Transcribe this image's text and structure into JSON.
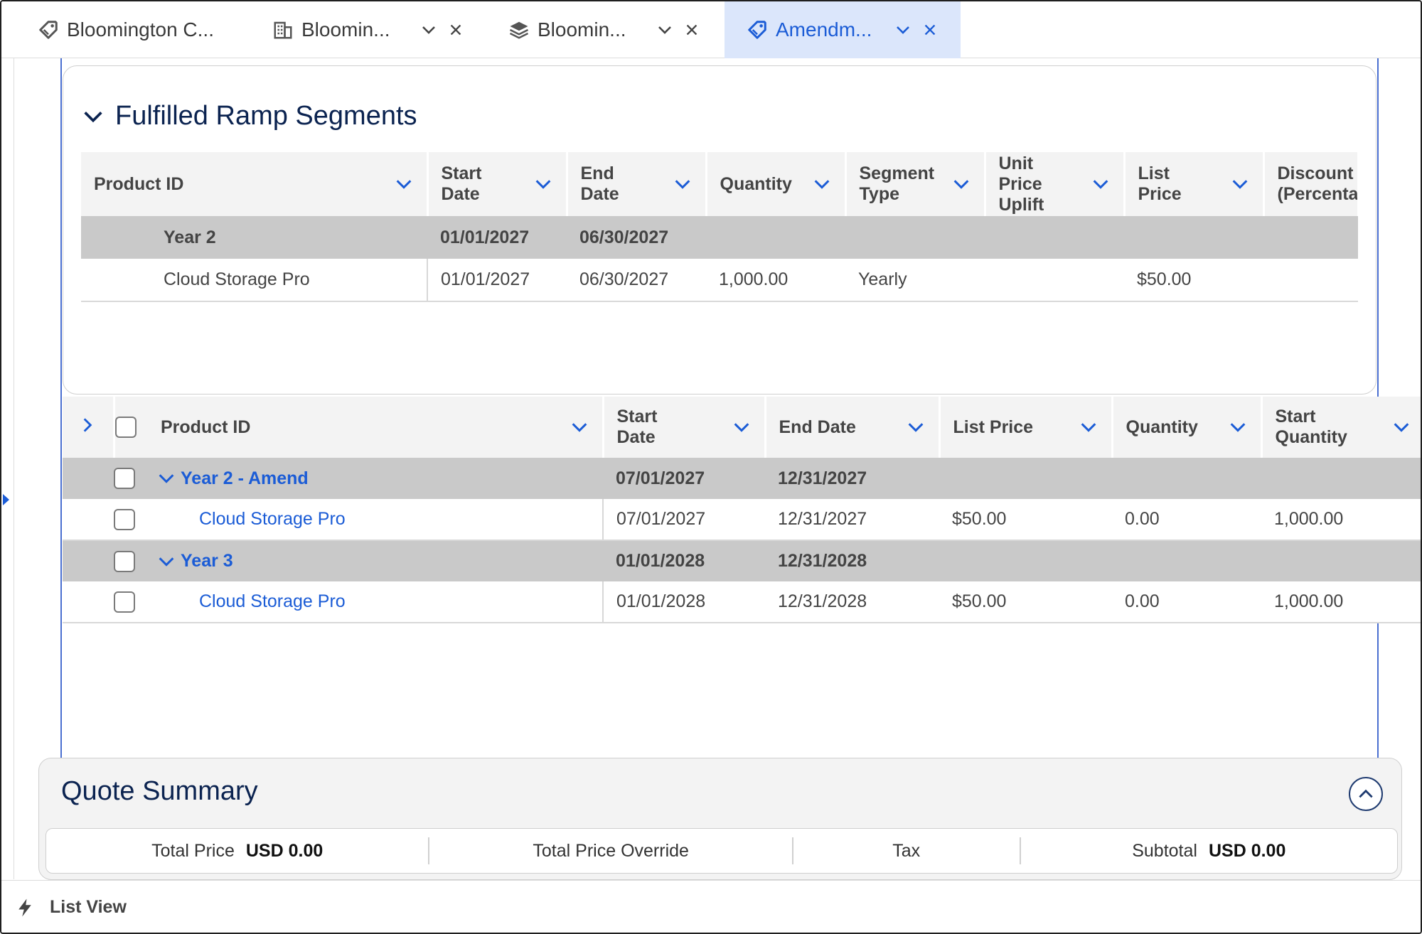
{
  "tabs": [
    {
      "label": "Bloomington C...",
      "icon": "price-tag-icon",
      "active": false
    },
    {
      "label": "Bloomin...",
      "icon": "building-icon",
      "active": false
    },
    {
      "label": "Bloomin...",
      "icon": "layers-icon",
      "active": false
    },
    {
      "label": "Amendm...",
      "icon": "price-tag-icon",
      "active": true
    }
  ],
  "fulfilled": {
    "title": "Fulfilled Ramp Segments",
    "columns": [
      "Product ID",
      "Start Date",
      "End Date",
      "Quantity",
      "Segment Type",
      "Unit Price Uplift",
      "List Price",
      "Discount (Percenta"
    ],
    "groups": [
      {
        "name": "Year 2",
        "start": "01/01/2027",
        "end": "06/30/2027",
        "rows": [
          {
            "product": "Cloud Storage Pro",
            "start": "01/01/2027",
            "end": "06/30/2027",
            "quantity": "1,000.00",
            "segment_type": "Yearly",
            "uplift": "",
            "list_price": "$50.00",
            "discount": ""
          }
        ]
      }
    ]
  },
  "lines": {
    "columns": [
      "Product ID",
      "Start Date",
      "End Date",
      "List Price",
      "Quantity",
      "Start Quantity"
    ],
    "groups": [
      {
        "name": "Year 2 - Amend",
        "start": "07/01/2027",
        "end": "12/31/2027",
        "rows": [
          {
            "product": "Cloud Storage Pro",
            "start": "07/01/2027",
            "end": "12/31/2027",
            "list_price": "$50.00",
            "quantity": "0.00",
            "start_quantity": "1,000.00"
          }
        ]
      },
      {
        "name": "Year 3",
        "start": "01/01/2028",
        "end": "12/31/2028",
        "rows": [
          {
            "product": "Cloud Storage Pro",
            "start": "01/01/2028",
            "end": "12/31/2028",
            "list_price": "$50.00",
            "quantity": "0.00",
            "start_quantity": "1,000.00"
          }
        ]
      }
    ]
  },
  "summary": {
    "title": "Quote Summary",
    "total_price_label": "Total Price",
    "total_price_value": "USD 0.00",
    "total_price_override_label": "Total Price Override",
    "tax_label": "Tax",
    "subtotal_label": "Subtotal",
    "subtotal_value": "USD 0.00"
  },
  "footer": {
    "list_view_label": "List View"
  },
  "colors": {
    "accent": "#1b5cd6",
    "active_tab_bg": "#dbe6fb",
    "group_row_bg": "#c9c9c9",
    "header_bg": "#f3f3f3",
    "title_color": "#0b2350"
  }
}
